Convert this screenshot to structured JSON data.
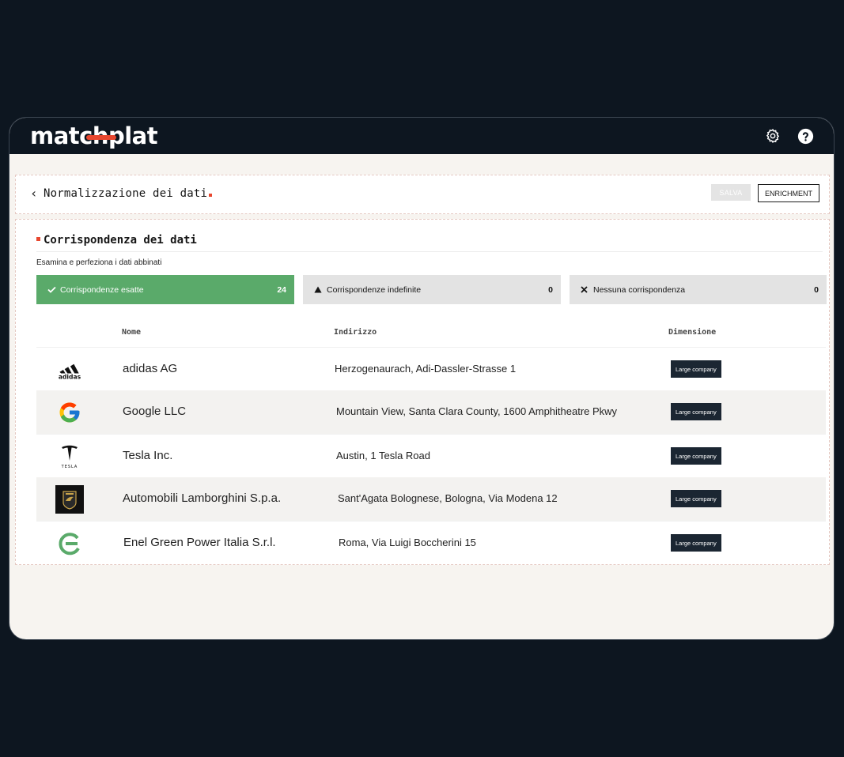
{
  "app": {
    "logo_text": "matchplat"
  },
  "header": {
    "back": "‹",
    "title": "Normalizzazione dei dati",
    "save_label": "SALVA",
    "enrichment_label": "ENRICHMENT"
  },
  "section": {
    "title": "Corrispondenza dei dati",
    "subtitle": "Esamina e perfeziona i dati abbinati"
  },
  "tabs": [
    {
      "label": "Corrispondenze esatte",
      "count": "24",
      "icon": "check-icon"
    },
    {
      "label": "Corrispondenze indefinite",
      "count": "0",
      "icon": "warning-icon"
    },
    {
      "label": "Nessuna corrispondenza",
      "count": "0",
      "icon": "close-icon"
    }
  ],
  "table": {
    "columns": [
      "Nome",
      "Indirizzo",
      "Dimensione"
    ],
    "rows": [
      {
        "logo": "adidas-logo",
        "logo_text": "adidas",
        "name": "adidas AG",
        "address": "Herzogenaurach, Adi-Dassler-Strasse 1",
        "size": "Large company"
      },
      {
        "logo": "google-logo",
        "name": "Google LLC",
        "address": "Mountain View, Santa Clara County, 1600 Amphitheatre Pkwy",
        "size": "Large company"
      },
      {
        "logo": "tesla-logo",
        "logo_text": "TESLA",
        "name": "Tesla Inc.",
        "address": "Austin, 1 Tesla Road",
        "size": "Large company"
      },
      {
        "logo": "lamborghini-logo",
        "name": "Automobili Lamborghini S.p.a.",
        "address": "Sant'Agata Bolognese, Bologna, Via Modena 12",
        "size": "Large company"
      },
      {
        "logo": "enel-green-power-logo",
        "name": "Enel Green Power Italia S.r.l.",
        "address": "Roma, Via Luigi Boccherini 15",
        "size": "Large company"
      }
    ]
  },
  "colors": {
    "background": "#0d1620",
    "accent_red": "#e8472f",
    "success_green": "#5aaa6a",
    "badge_dark": "#1b2632"
  }
}
